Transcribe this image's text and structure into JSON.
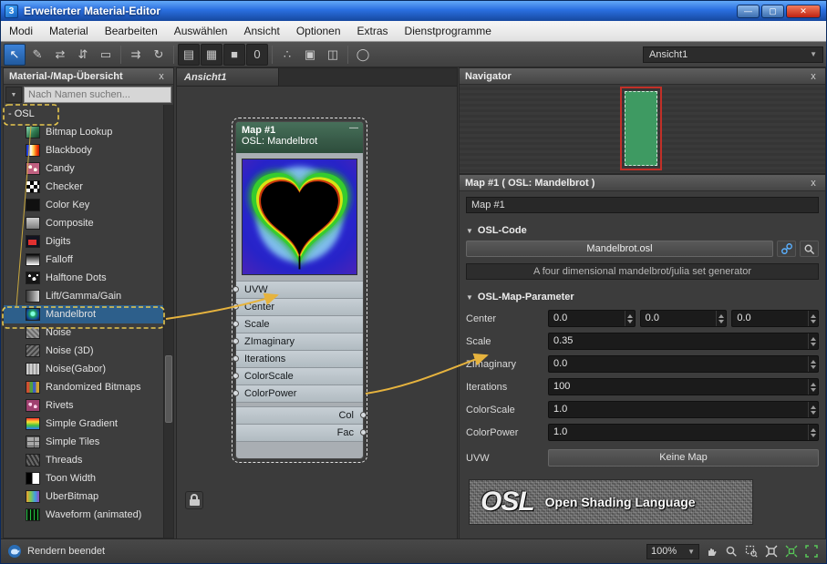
{
  "window": {
    "title": "Erweiterter Material-Editor",
    "app_badge": "3"
  },
  "glyphs": {
    "minimize": "—",
    "maximize": "▢",
    "close_window": "✕",
    "close_panel": "x",
    "dropdown": "▼",
    "section_arrow": "▼",
    "node_minimize": "—"
  },
  "menu": {
    "items": [
      "Modi",
      "Material",
      "Bearbeiten",
      "Auswählen",
      "Ansicht",
      "Optionen",
      "Extras",
      "Dienstprogramme"
    ]
  },
  "toolbar": {
    "view_selector": "Ansicht1",
    "buttons": [
      {
        "name": "select-tool",
        "glyph": "↖"
      },
      {
        "name": "pick-material",
        "glyph": "✎"
      },
      {
        "name": "assign-to-selection",
        "glyph": "⇄"
      },
      {
        "name": "put-to-library",
        "glyph": "⇵"
      },
      {
        "name": "delete-selected",
        "glyph": "▭"
      },
      {
        "name": "move-children",
        "glyph": "⇉"
      },
      {
        "name": "update-previews",
        "glyph": "↻"
      },
      {
        "name": "show-grid",
        "glyph": "▤"
      },
      {
        "name": "show-background",
        "glyph": "▦"
      },
      {
        "name": "show-checker",
        "glyph": "■"
      },
      {
        "name": "material-id-channel",
        "glyph": "0"
      },
      {
        "name": "hide-unused-nodeslots",
        "glyph": "∴"
      },
      {
        "name": "layout-all",
        "glyph": "▣"
      },
      {
        "name": "layout-children",
        "glyph": "◫"
      },
      {
        "name": "pan-tool",
        "glyph": "◯"
      }
    ]
  },
  "browser": {
    "title": "Material-/Map-Übersicht",
    "search_placeholder": "Nach Namen suchen...",
    "root_item": "- OSL",
    "items": [
      {
        "label": "Bitmap Lookup",
        "icon": "bitmap-lookup-icon"
      },
      {
        "label": "Blackbody",
        "icon": "blackbody-icon"
      },
      {
        "label": "Candy",
        "icon": "candy-icon"
      },
      {
        "label": "Checker",
        "icon": "checker-icon"
      },
      {
        "label": "Color Key",
        "icon": "color-key-icon"
      },
      {
        "label": "Composite",
        "icon": "composite-icon"
      },
      {
        "label": "Digits",
        "icon": "digits-icon"
      },
      {
        "label": "Falloff",
        "icon": "falloff-icon"
      },
      {
        "label": "Halftone Dots",
        "icon": "halftone-dots-icon"
      },
      {
        "label": "Lift/Gamma/Gain",
        "icon": "lift-gamma-gain-icon"
      },
      {
        "label": "Mandelbrot",
        "icon": "mandelbrot-icon"
      },
      {
        "label": "Noise",
        "icon": "noise-icon"
      },
      {
        "label": "Noise (3D)",
        "icon": "noise-3d-icon"
      },
      {
        "label": "Noise(Gabor)",
        "icon": "noise-gabor-icon"
      },
      {
        "label": "Randomized Bitmaps",
        "icon": "randomized-bitmaps-icon"
      },
      {
        "label": "Rivets",
        "icon": "rivets-icon"
      },
      {
        "label": "Simple Gradient",
        "icon": "simple-gradient-icon"
      },
      {
        "label": "Simple Tiles",
        "icon": "simple-tiles-icon"
      },
      {
        "label": "Threads",
        "icon": "threads-icon"
      },
      {
        "label": "Toon Width",
        "icon": "toon-width-icon"
      },
      {
        "label": "UberBitmap",
        "icon": "uberbitmap-icon"
      },
      {
        "label": "Waveform (animated)",
        "icon": "waveform-animated-icon"
      }
    ]
  },
  "viewport": {
    "tab": "Ansicht1"
  },
  "node": {
    "title": "Map #1",
    "subtitle": "OSL: Mandelbrot",
    "inputs": [
      "UVW",
      "Center",
      "Scale",
      "ZImaginary",
      "Iterations",
      "ColorScale",
      "ColorPower"
    ],
    "outputs": [
      "Col",
      "Fac"
    ]
  },
  "navigator": {
    "title": "Navigator"
  },
  "params": {
    "title": "Map #1  ( OSL: Mandelbrot )",
    "name_value": "Map #1",
    "code_section": "OSL-Code",
    "file_button": "Mandelbrot.osl",
    "description": "A four dimensional mandelbrot/julia set generator",
    "param_section": "OSL-Map-Parameter",
    "rows": [
      {
        "label": "Center",
        "values": [
          "0.0",
          "0.0",
          "0.0"
        ]
      },
      {
        "label": "Scale",
        "values": [
          "0.35"
        ]
      },
      {
        "label": "ZImaginary",
        "values": [
          "0.0"
        ]
      },
      {
        "label": "Iterations",
        "values": [
          "100"
        ]
      },
      {
        "label": "ColorScale",
        "values": [
          "1.0"
        ]
      },
      {
        "label": "ColorPower",
        "values": [
          "1.0"
        ]
      }
    ],
    "uvw_label": "UVW",
    "uvw_button": "Keine Map",
    "banner": {
      "logo": "OSL",
      "text": "Open Shading Language"
    }
  },
  "statusbar": {
    "message": "Rendern beendet",
    "zoom": "100%"
  },
  "colors": {
    "accent_blue": "#2e74c9",
    "selection_blue": "#2d5f8b",
    "annotation_yellow": "#e6b33e",
    "node_header_green": "#3e6a52",
    "close_red": "#c02818"
  }
}
